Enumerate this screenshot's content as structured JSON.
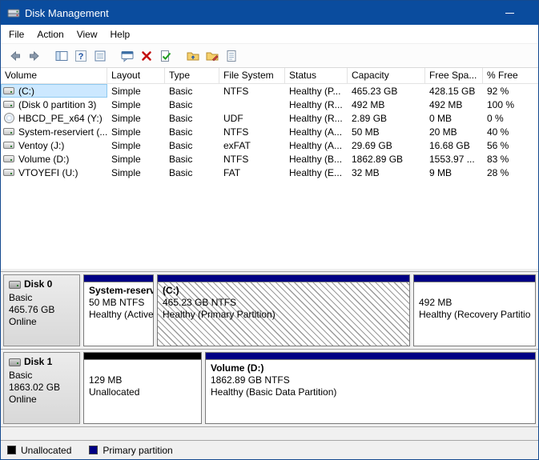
{
  "window": {
    "title": "Disk Management"
  },
  "menu": {
    "items": [
      "File",
      "Action",
      "View",
      "Help"
    ]
  },
  "toolbar": {
    "icons": [
      "back",
      "forward",
      "show-console-tree",
      "help",
      "export-list",
      "action-dialog",
      "delete-volume",
      "mark-partition-active",
      "change-drive-letter",
      "format",
      "properties"
    ]
  },
  "table": {
    "columns": [
      "Volume",
      "Layout",
      "Type",
      "File System",
      "Status",
      "Capacity",
      "Free Spa...",
      "% Free"
    ],
    "rows": [
      {
        "volume": "(C:)",
        "layout": "Simple",
        "type": "Basic",
        "fs": "NTFS",
        "status": "Healthy (P...",
        "capacity": "465.23 GB",
        "free": "428.15 GB",
        "pct_free": "92 %",
        "icon": "drive",
        "selected": true
      },
      {
        "volume": "(Disk 0 partition 3)",
        "layout": "Simple",
        "type": "Basic",
        "fs": "",
        "status": "Healthy (R...",
        "capacity": "492 MB",
        "free": "492 MB",
        "pct_free": "100 %",
        "icon": "drive",
        "selected": false
      },
      {
        "volume": "HBCD_PE_x64 (Y:)",
        "layout": "Simple",
        "type": "Basic",
        "fs": "UDF",
        "status": "Healthy (R...",
        "capacity": "2.89 GB",
        "free": "0 MB",
        "pct_free": "0 %",
        "icon": "cd",
        "selected": false
      },
      {
        "volume": "System-reserviert (...",
        "layout": "Simple",
        "type": "Basic",
        "fs": "NTFS",
        "status": "Healthy (A...",
        "capacity": "50 MB",
        "free": "20 MB",
        "pct_free": "40 %",
        "icon": "drive",
        "selected": false
      },
      {
        "volume": "Ventoy (J:)",
        "layout": "Simple",
        "type": "Basic",
        "fs": "exFAT",
        "status": "Healthy (A...",
        "capacity": "29.69 GB",
        "free": "16.68 GB",
        "pct_free": "56 %",
        "icon": "drive",
        "selected": false
      },
      {
        "volume": "Volume (D:)",
        "layout": "Simple",
        "type": "Basic",
        "fs": "NTFS",
        "status": "Healthy (B...",
        "capacity": "1862.89 GB",
        "free": "1553.97 ...",
        "pct_free": "83 %",
        "icon": "drive",
        "selected": false
      },
      {
        "volume": "VTOYEFI (U:)",
        "layout": "Simple",
        "type": "Basic",
        "fs": "FAT",
        "status": "Healthy (E...",
        "capacity": "32 MB",
        "free": "9 MB",
        "pct_free": "28 %",
        "icon": "drive",
        "selected": false
      }
    ]
  },
  "disks": [
    {
      "name": "Disk 0",
      "kind": "Basic",
      "size": "465.76 GB",
      "status": "Online",
      "partitions": [
        {
          "title": "System-reserviert",
          "line2": "50 MB NTFS",
          "line3": "Healthy (Active",
          "bar": "primary",
          "selected": false
        },
        {
          "title": "(C:)",
          "line2": "465.23 GB NTFS",
          "line3": "Healthy (Primary Partition)",
          "bar": "primary",
          "selected": true
        },
        {
          "title": "",
          "line2": "492 MB",
          "line3": "Healthy (Recovery Partitio",
          "bar": "primary",
          "selected": false
        }
      ]
    },
    {
      "name": "Disk 1",
      "kind": "Basic",
      "size": "1863.02 GB",
      "status": "Online",
      "partitions": [
        {
          "title": "",
          "line2": "129 MB",
          "line3": "Unallocated",
          "bar": "unallocated",
          "selected": false
        },
        {
          "title": "Volume (D:)",
          "line2": "1862.89 GB NTFS",
          "line3": "Healthy (Basic Data Partition)",
          "bar": "primary",
          "selected": false
        }
      ]
    }
  ],
  "legend": {
    "items": [
      {
        "label": "Unallocated",
        "color": "#000000"
      },
      {
        "label": "Primary partition",
        "color": "#000084"
      }
    ]
  },
  "colors": {
    "titlebar": "#0a4c9e",
    "primary_partition": "#000084",
    "unallocated": "#000000",
    "selection": "#cce8ff"
  }
}
